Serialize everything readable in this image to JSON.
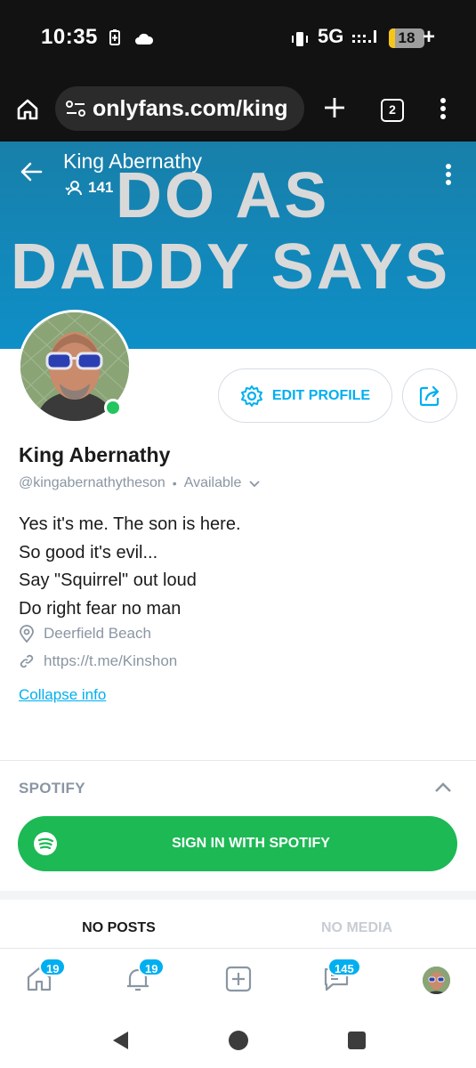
{
  "status_bar": {
    "time": "10:35",
    "network": "5G",
    "battery": "18",
    "battery_level": 0.18,
    "icons": [
      "battery-saver-icon",
      "cloud-icon",
      "vibrate-icon",
      "signal-icon",
      "charging-plus-icon"
    ]
  },
  "browser": {
    "url": "onlyfans.com/king",
    "tab_count": "2",
    "icons": [
      "home-icon",
      "site-settings-icon",
      "new-tab-icon",
      "menu-dots-icon"
    ]
  },
  "cover": {
    "line1": "DO AS",
    "line2": "DADDY SAYS",
    "name": "King Abernathy",
    "fans_count": "141",
    "bg_color": "#0e8fc8"
  },
  "profile": {
    "edit_label": "EDIT PROFILE",
    "name": "King Abernathy",
    "handle": "@kingabernathytheson",
    "separator": "•",
    "status": "Available",
    "bio": [
      "Yes it's me. The son is here.",
      "So good it's evil...",
      "Say \"Squirrel\" out loud",
      "Do right fear no man"
    ],
    "location": "Deerfield Beach",
    "link": "https://t.me/Kinshon",
    "collapse_label": "Collapse info"
  },
  "spotify": {
    "title": "SPOTIFY",
    "button_label": "SIGN IN WITH SPOTIFY",
    "color": "#1db954"
  },
  "tabs": {
    "posts": "NO POSTS",
    "media": "NO MEDIA"
  },
  "bottom_nav": {
    "home_badge": "19",
    "notifications_badge": "19",
    "messages_badge": "145",
    "accent": "#00aff0"
  }
}
